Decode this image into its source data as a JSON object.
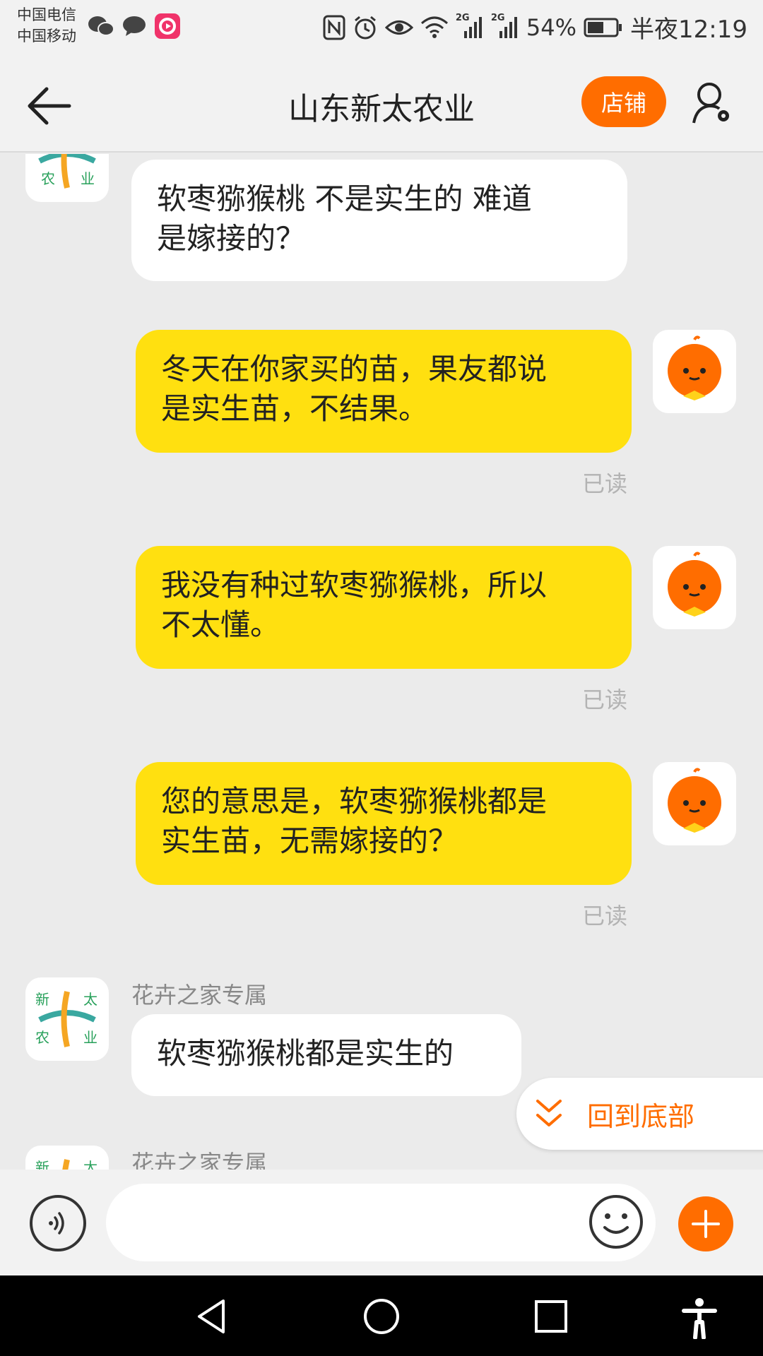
{
  "status_bar": {
    "carrier1": "中国电信",
    "carrier2": "中国移动",
    "network1": "2G",
    "network2": "2G",
    "battery": "54%",
    "time": "半夜12:19"
  },
  "header": {
    "title": "山东新太农业",
    "shop_label": "店铺"
  },
  "messages": [
    {
      "dir": "in",
      "text_line1": "软枣猕猴桃 不是实生的  难道",
      "text_line2": "是嫁接的？"
    },
    {
      "dir": "out",
      "text_line1": "冬天在你家买的苗，果友都说",
      "text_line2": "是实生苗，不结果。",
      "status": "已读"
    },
    {
      "dir": "out",
      "text_line1": "我没有种过软枣猕猴桃，所以",
      "text_line2": "不太懂。",
      "status": "已读"
    },
    {
      "dir": "out",
      "text_line1": "您的意思是，软枣猕猴桃都是",
      "text_line2": "实生苗，无需嫁接的？",
      "status": "已读"
    },
    {
      "dir": "in",
      "sender": "花卉之家专属",
      "text": "软枣猕猴桃都是实生的"
    },
    {
      "dir": "in",
      "sender": "花卉之家专属"
    }
  ],
  "shop_logo": {
    "chars": [
      "新",
      "太",
      "农",
      "业"
    ]
  },
  "back_to_bottom_label": "回到底部",
  "input": {
    "placeholder": ""
  },
  "colors": {
    "accent": "#ff6d00",
    "out_bubble": "#ffe010",
    "in_bubble": "#ffffff",
    "background": "#ebebeb"
  }
}
